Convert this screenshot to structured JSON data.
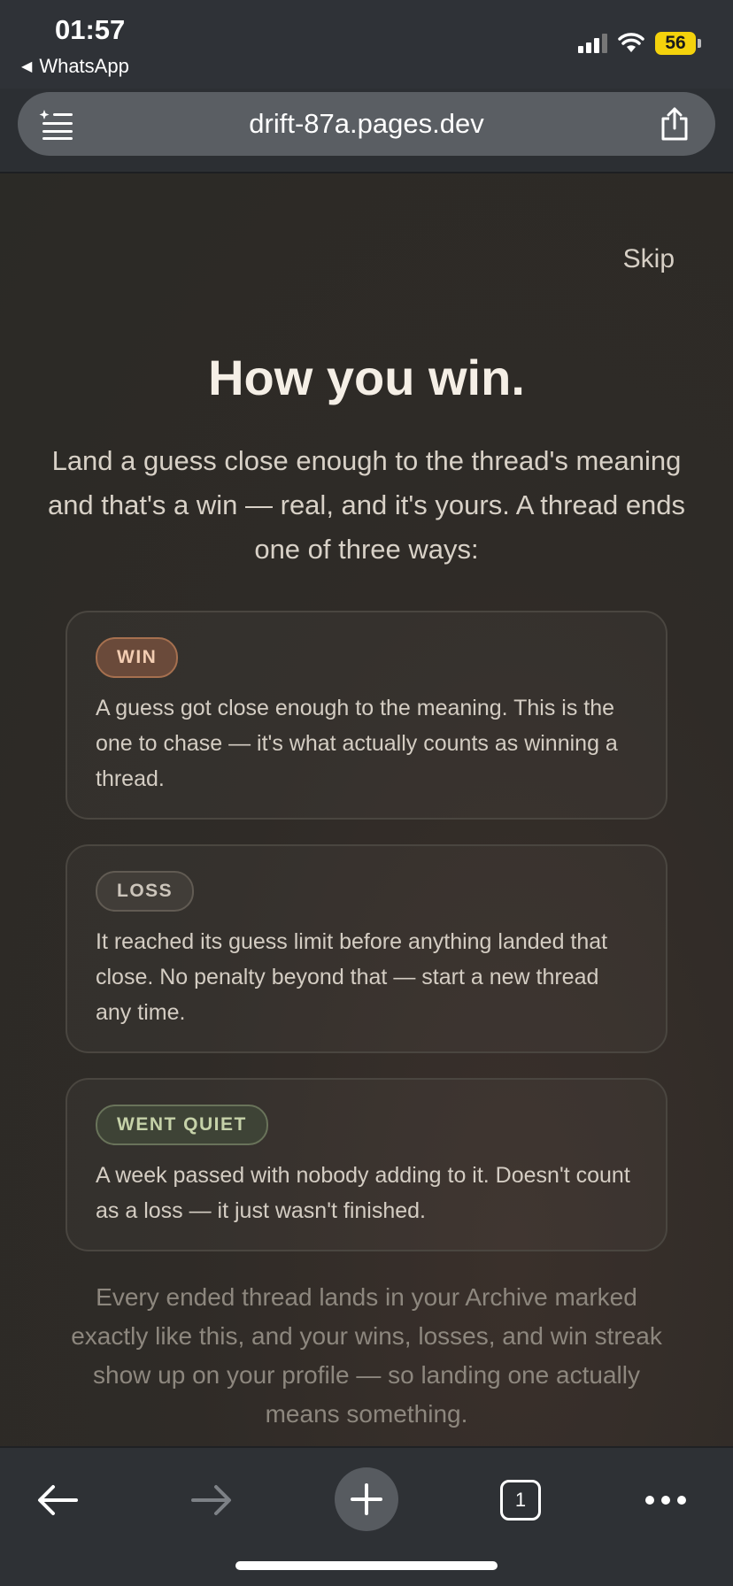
{
  "status": {
    "time": "01:57",
    "back_app": "WhatsApp",
    "battery": "56"
  },
  "browser": {
    "url": "drift-87a.pages.dev",
    "tab_count": "1"
  },
  "page": {
    "skip_label": "Skip",
    "title": "How you win.",
    "intro": "Land a guess close enough to the thread's meaning and that's a win — real, and it's yours. A thread ends one of three ways:",
    "outcomes": [
      {
        "badge": "WIN",
        "text": "A guess got close enough to the meaning. This is the one to chase — it's what actually counts as winning a thread."
      },
      {
        "badge": "LOSS",
        "text": "It reached its guess limit before anything landed that close. No penalty beyond that — start a new thread any time."
      },
      {
        "badge": "WENT QUIET",
        "text": "A week passed with nobody adding to it. Doesn't count as a loss — it just wasn't finished."
      }
    ],
    "footer_note": "Every ended thread lands in your Archive marked exactly like this, and your wins, losses, and win streak show up on your profile — so landing one actually means something."
  },
  "icons": {
    "menu": "tab-menu-icon",
    "share": "share-icon",
    "back": "back-arrow-icon",
    "forward": "forward-arrow-icon",
    "add": "plus-icon",
    "tabs": "tabs-icon",
    "more": "more-icon"
  },
  "colors": {
    "win_badge": "#6a4a3a",
    "loss_badge": "#413d38",
    "quiet_badge": "#3e4336",
    "battery": "#f4d20c"
  }
}
